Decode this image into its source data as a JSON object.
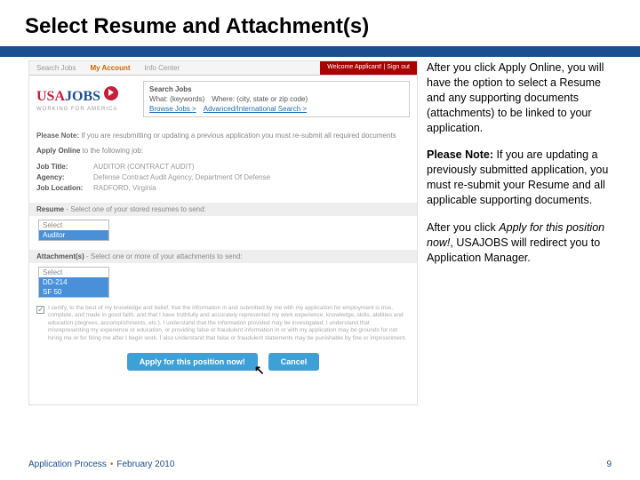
{
  "title": "Select Resume and Attachment(s)",
  "screenshot": {
    "tabs": {
      "search": "Search Jobs",
      "account": "My Account",
      "info": "Info Center"
    },
    "welcome": "Welcome Applicant! | Sign out",
    "logo": {
      "usa": "USA",
      "jobs": "JOBS",
      "tagline": "WORKING FOR AMERICA"
    },
    "search": {
      "title": "Search Jobs",
      "what": "What: (keywords)",
      "where": "Where: (city, state or zip code)",
      "browse": "Browse Jobs >",
      "adv": "Advanced/International Search >"
    },
    "note": {
      "label": "Please Note:",
      "text": " If you are resubmitting or updating a previous application you must re-submit all required documents"
    },
    "apply": {
      "bold": "Apply Online",
      "rest": " to the following job:"
    },
    "job": {
      "t_label": "Job Title:",
      "t_val": "AUDITOR (CONTRACT AUDIT)",
      "a_label": "Agency:",
      "a_val": "Defense Contract Audit Agency, Department Of Defense",
      "l_label": "Job Location:",
      "l_val": "RADFORD, Virginia"
    },
    "resume": {
      "label": "Resume",
      "rest": " - Select one of your stored resumes to send:",
      "opt1": "Select",
      "opt2": "Auditor"
    },
    "attach": {
      "label": "Attachment(s)",
      "rest": " - Select one or more of your attachments to send:",
      "opt1": "Select",
      "opt2": "DD-214",
      "opt3": "SF 50"
    },
    "cert": "I certify, to the best of my knowledge and belief, that the information in and submitted by me with my application for employment is true, complete, and made in good faith, and that I have truthfully and accurately represented my work experience, knowledge, skills, abilities and education (degrees, accomplishments, etc.). I understand that the information provided may be investigated. I understand that misrepresenting my experience or education, or providing false or fraudulent information in or with my application may be grounds for not hiring me or for firing me after I begin work. I also understand that false or fraudulent statements may be punishable by fine or imprisonment.",
    "apply_btn": "Apply for this position now!",
    "cancel_btn": "Cancel"
  },
  "sidebar": {
    "p1": "After you click Apply Online, you will have the option to select a Resume and any supporting documents (attachments) to be linked to your application.",
    "p2_bold": "Please Note:",
    "p2_rest": " If you are updating a previously submitted application, you must re-submit your Resume and all applicable supporting documents.",
    "p3a": "After you click ",
    "p3i": "Apply for this position now!",
    "p3b": ", USAJOBS will redirect you to Application Manager."
  },
  "footer": {
    "left1": "Application Process",
    "left2": "February 2010",
    "page": "9"
  }
}
